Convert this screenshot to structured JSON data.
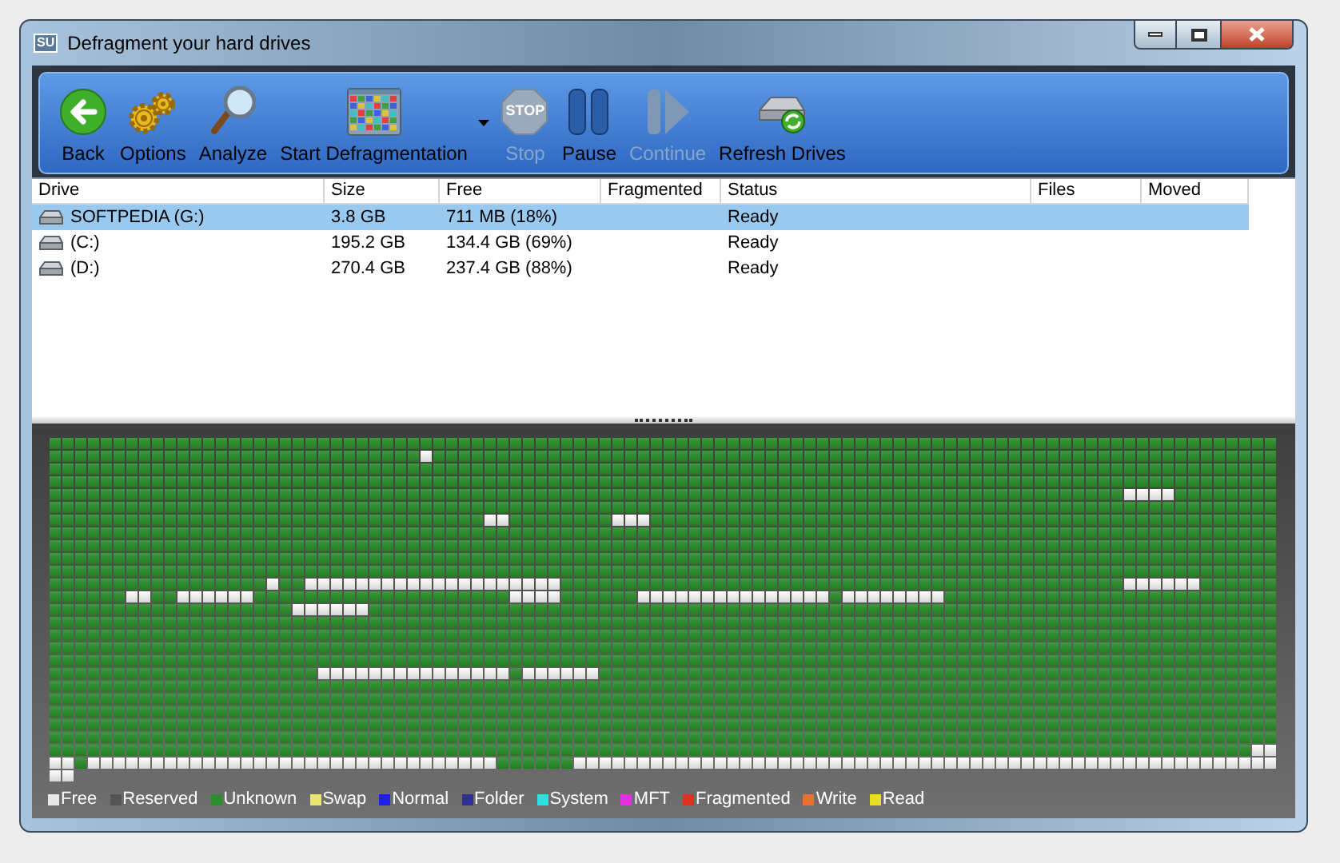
{
  "window": {
    "title": "Defragment your hard drives",
    "app_badge": "SU"
  },
  "toolbar": {
    "buttons": [
      {
        "label": "Back",
        "kind": "back",
        "disabled": false
      },
      {
        "label": "Options",
        "kind": "options",
        "disabled": false
      },
      {
        "label": "Analyze",
        "kind": "analyze",
        "disabled": false
      },
      {
        "label": "Start Defragmentation",
        "kind": "defrag",
        "disabled": false,
        "has_menu": true
      },
      {
        "label": "Stop",
        "kind": "stop",
        "disabled": true,
        "icon_text": "STOP"
      },
      {
        "label": "Pause",
        "kind": "pause",
        "disabled": false
      },
      {
        "label": "Continue",
        "kind": "continue",
        "disabled": true
      },
      {
        "label": "Refresh Drives",
        "kind": "refresh",
        "disabled": false
      }
    ]
  },
  "table": {
    "columns": [
      "Drive",
      "Size",
      "Free",
      "Fragmented",
      "Status",
      "Files",
      "Moved"
    ],
    "rows": [
      {
        "selected": true,
        "cells": [
          "SOFTPEDIA (G:)",
          "3.8 GB",
          "711 MB (18%)",
          "",
          "Ready",
          "",
          ""
        ]
      },
      {
        "selected": false,
        "cells": [
          "(C:)",
          "195.2 GB",
          "134.4 GB (69%)",
          "",
          "Ready",
          "",
          ""
        ]
      },
      {
        "selected": false,
        "cells": [
          "(D:)",
          "270.4 GB",
          "237.4 GB (88%)",
          "",
          "Ready",
          "",
          ""
        ]
      }
    ]
  },
  "legend": [
    {
      "label": "Free",
      "color": "#e8e8e8"
    },
    {
      "label": "Reserved",
      "color": "#555555"
    },
    {
      "label": "Unknown",
      "color": "#2e8b2e"
    },
    {
      "label": "Swap",
      "color": "#e8e870"
    },
    {
      "label": "Normal",
      "color": "#2020e0"
    },
    {
      "label": "Folder",
      "color": "#303090"
    },
    {
      "label": "System",
      "color": "#30e0e0"
    },
    {
      "label": "MFT",
      "color": "#e030e0"
    },
    {
      "label": "Fragmented",
      "color": "#e03020"
    },
    {
      "label": "Write",
      "color": "#e87030"
    },
    {
      "label": "Read",
      "color": "#e8e020"
    }
  ]
}
